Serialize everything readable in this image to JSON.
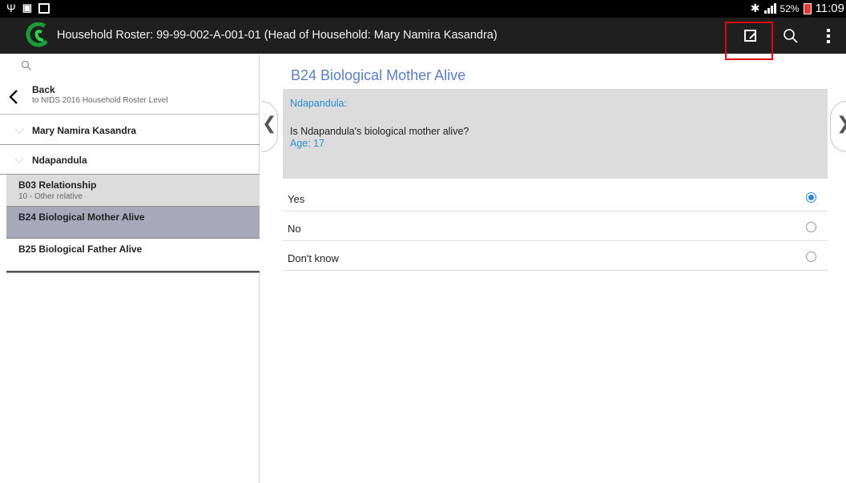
{
  "status_bar": {
    "left_icons": [
      "usb-icon",
      "notification-icon",
      "screenshot-icon"
    ],
    "battery": "52%",
    "time": "11:09"
  },
  "action_bar": {
    "title": "Household Roster: 99-99-002-A-001-01 (Head of Household: Mary Namira Kasandra)",
    "actions": [
      "edit-icon",
      "search-icon",
      "overflow-menu-icon"
    ],
    "highlight_color": "#e3000f"
  },
  "sidebar": {
    "back": {
      "label": "Back",
      "sublabel": "to NIDS 2016 Household Roster Level"
    },
    "tree": [
      {
        "label": "Mary Namira Kasandra"
      },
      {
        "label": "Ndapandula"
      }
    ],
    "fields": [
      {
        "label": "B03 Relationship",
        "value": "10 - Other relative"
      },
      {
        "label": "B24 Biological Mother Alive",
        "value": ""
      },
      {
        "label": "B25 Biological Father Alive",
        "value": ""
      }
    ],
    "selected_index": 1
  },
  "question": {
    "title": "B24 Biological Mother Alive",
    "person": "Ndapandula:",
    "text": "Is Ndapandula's biological mother alive?",
    "age": "Age: 17",
    "options": [
      {
        "label": "Yes",
        "selected": true
      },
      {
        "label": "No",
        "selected": false
      },
      {
        "label": "Don't know",
        "selected": false
      }
    ]
  },
  "colors": {
    "accent": "#2e86de",
    "title_blue": "#5a7fc5",
    "selected_row": "#a8a8bb"
  }
}
